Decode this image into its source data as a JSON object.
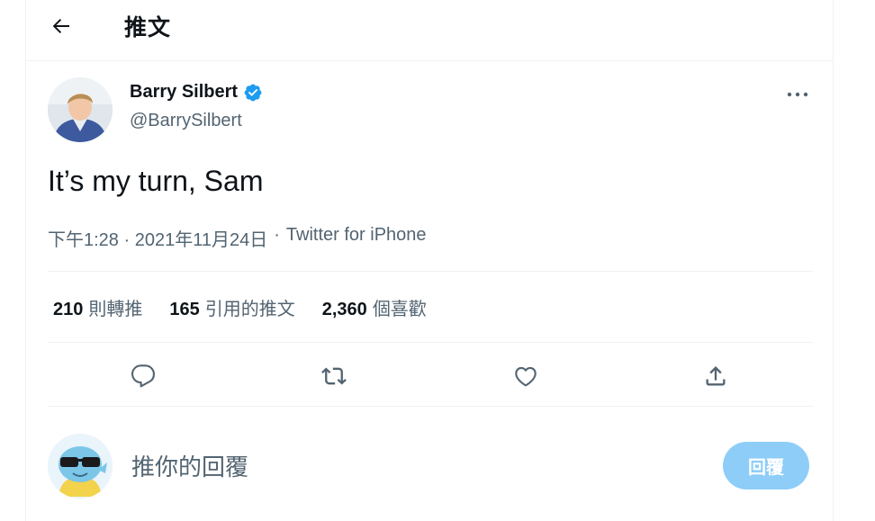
{
  "header": {
    "back_icon": "arrow-left-icon",
    "title": "推文"
  },
  "tweet": {
    "author_name": "Barry Silbert",
    "verified": true,
    "handle": "@BarrySilbert",
    "text": "It’s my turn, Sam",
    "time": "下午1:28",
    "date": "2021年11月24日",
    "separator": "·",
    "source": "Twitter for iPhone"
  },
  "stats": [
    {
      "count": "210",
      "label": "則轉推"
    },
    {
      "count": "165",
      "label": "引用的推文"
    },
    {
      "count": "2,360",
      "label": "個喜歡"
    }
  ],
  "actions": [
    "reply-icon",
    "retweet-icon",
    "like-icon",
    "share-icon"
  ],
  "reply": {
    "placeholder": "推你的回覆",
    "button_label": "回覆"
  },
  "colors": {
    "accent": "#1d9bf0",
    "reply_button": "#8ecdf8",
    "muted_text": "#536471",
    "divider": "#eff3f4"
  }
}
